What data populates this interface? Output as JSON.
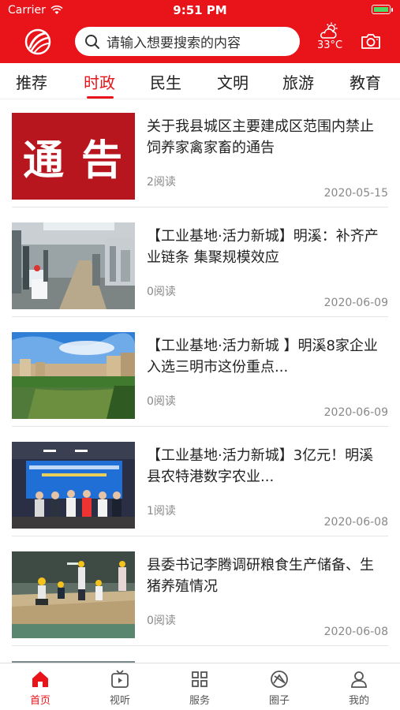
{
  "status_bar": {
    "carrier": "Carrier",
    "time": "9:51 PM"
  },
  "header": {
    "search_placeholder": "请输入想要搜索的内容",
    "temperature": "33°C"
  },
  "tabs": [
    {
      "label": "推荐",
      "active": false
    },
    {
      "label": "时政",
      "active": true
    },
    {
      "label": "民生",
      "active": false
    },
    {
      "label": "文明",
      "active": false
    },
    {
      "label": "旅游",
      "active": false
    },
    {
      "label": "教育",
      "active": false
    }
  ],
  "news": [
    {
      "title": "关于我县城区主要建成区范围内禁止饲养家禽家畜的通告",
      "reads": "2阅读",
      "date": "2020-05-15",
      "thumb_text": "通 告"
    },
    {
      "title": "【工业基地·活力新城】明溪：补齐产业链条 集聚规模效应",
      "reads": "0阅读",
      "date": "2020-06-09"
    },
    {
      "title": "【工业基地·活力新城 】明溪8家企业入选三明市这份重点...",
      "reads": "0阅读",
      "date": "2020-06-09"
    },
    {
      "title": "【工业基地·活力新城】3亿元！明溪县农特港数字农业...",
      "reads": "1阅读",
      "date": "2020-06-08"
    },
    {
      "title": "县委书记李腾调研粮食生产储备、生猪养殖情况",
      "reads": "0阅读",
      "date": "2020-06-08"
    }
  ],
  "bottom_nav": [
    {
      "label": "首页",
      "icon": "home-icon",
      "active": true
    },
    {
      "label": "视听",
      "icon": "tv-icon",
      "active": false
    },
    {
      "label": "服务",
      "icon": "grid-icon",
      "active": false
    },
    {
      "label": "圈子",
      "icon": "circle-icon",
      "active": false
    },
    {
      "label": "我的",
      "icon": "user-icon",
      "active": false
    }
  ],
  "colors": {
    "brand": "#e8141a",
    "meta_text": "#888888"
  }
}
